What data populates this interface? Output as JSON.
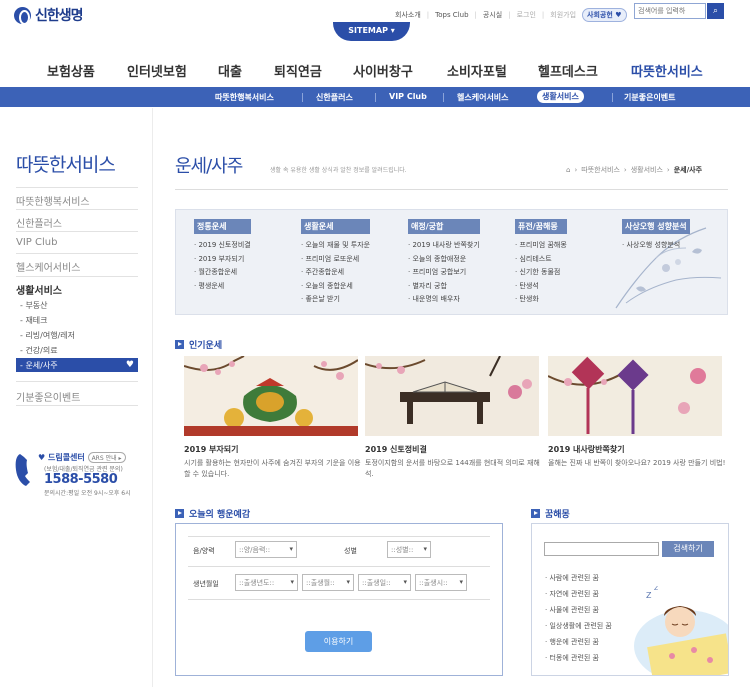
{
  "header": {
    "logo": "신한생명",
    "util_links": [
      "회사소개",
      "Tops Club",
      "공시실",
      "로그인",
      "회원가입"
    ],
    "social_badge": "사회공헌",
    "search_placeholder": "검색어를 입력하",
    "sitemap_label": "SITEMAP"
  },
  "gnb": [
    "보험상품",
    "인터넷보험",
    "대출",
    "퇴직연금",
    "사이버창구",
    "소비자포털",
    "헬프데스크",
    "따뜻한서비스"
  ],
  "subnav": [
    "따뜻한행복서비스",
    "신한플러스",
    "VIP Club",
    "헬스케어서비스",
    "생활서비스",
    "기분좋은이벤트"
  ],
  "sidebar": {
    "title": "따뜻한서비스",
    "items": [
      "따뜻한행복서비스",
      "신한플러스",
      "VIP Club",
      "헬스케어서비스",
      "생활서비스",
      "기분좋은이벤트"
    ],
    "sub_items": [
      "부동산",
      "재테크",
      "리빙/여행/레저",
      "건강/의료",
      "운세/사주"
    ],
    "callcenter": {
      "title": "드림콜센터",
      "ars": "ARS 안내",
      "sub": "(보험/대출/퇴직연금 관련 문의)",
      "number": "1588-5580",
      "hours": "문의시간:평일 오전 9시~오후 6시"
    }
  },
  "page": {
    "title": "운세/사주",
    "desc": "생활 속 유용한 생활 상식과 알찬 정보를 알려드립니다.",
    "breadcrumb": [
      "따뜻한서비스",
      "생활서비스",
      "운세/사주"
    ]
  },
  "categories": [
    {
      "head": "정통운세",
      "items": [
        "2019 신토정비결",
        "2019 부자되기",
        "월간종합운세",
        "평생운세"
      ]
    },
    {
      "head": "생활운세",
      "items": [
        "오늘의 재물 및 투자운",
        "프리미엄 로또운세",
        "주간종합운세",
        "오늘의 종합운세",
        "좋은날 받기"
      ]
    },
    {
      "head": "애정/궁합",
      "items": [
        "2019 내사랑 반쪽찾기",
        "오늘의 종합애정운",
        "프리미엄 궁합보기",
        "별자리 궁합",
        "내운명의 배우자"
      ]
    },
    {
      "head": "퓨전/꿈해몽",
      "items": [
        "프리미엄 꿈해몽",
        "심리테스트",
        "신기한 동물점",
        "탄생석",
        "탄생화"
      ]
    },
    {
      "head": "사상오행 성향분석",
      "items": [
        "사상오행 성향분석"
      ]
    }
  ],
  "popular": {
    "title": "인기운세",
    "cards": [
      {
        "title": "2019 부자되기",
        "desc": "시기를 활용하는 현자만이 사주에 숨겨진 부자의 기운을 이용할 수 있습니다."
      },
      {
        "title": "2019 신토정비결",
        "desc": "토정이지함의 운서를 바탕으로 144괘를 현대적 의미로 재해석."
      },
      {
        "title": "2019 내사랑반쪽찾기",
        "desc": "올해는 진짜 내 반쪽이 찾아오나요? 2019 사랑 만들기 비법!"
      }
    ]
  },
  "today": {
    "title": "오늘의 행운예감",
    "labels": {
      "calendar": "음/양력",
      "gender": "성별",
      "birth": "생년월일"
    },
    "selects": {
      "calendar": "::양/음력::",
      "gender": "::성별::",
      "year": "::출생년도::",
      "month": "::출생월::",
      "day": "::출생일::",
      "hour": "::출생시::"
    },
    "button": "이용하기"
  },
  "dream": {
    "title": "꿈해몽",
    "button": "검색하기",
    "items": [
      "사람에 관련된 꿈",
      "자연에 관련된 꿈",
      "사물에 관련된 꿈",
      "일상생활에 관련된 꿈",
      "행운에 관련된 꿈",
      "터몽에 관련된 꿈"
    ]
  },
  "colors": {
    "brand": "#2b4ea8",
    "subnav": "#3c62b7",
    "category_head": "#6b86b9"
  }
}
